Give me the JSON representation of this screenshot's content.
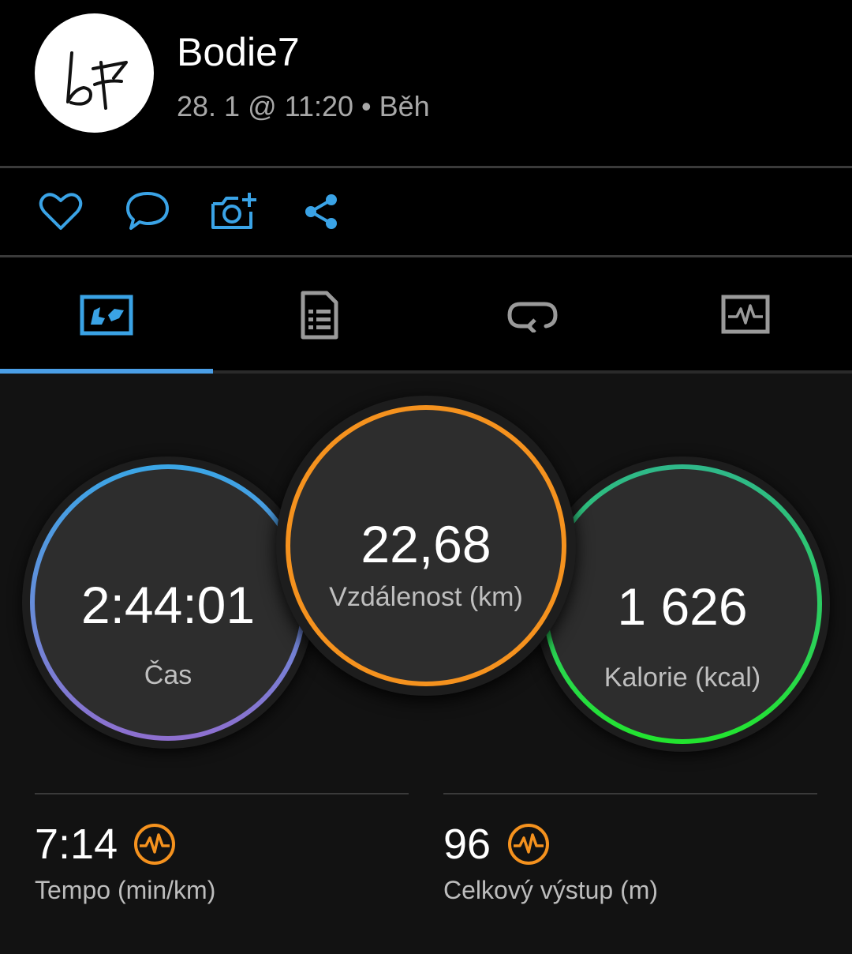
{
  "header": {
    "username": "Bodie7",
    "subtitle": "28. 1 @ 11:20 • Běh",
    "avatar_initials": "b7"
  },
  "actions": {
    "icons": [
      "heart-icon",
      "comment-icon",
      "add-photo-icon",
      "share-icon"
    ],
    "accent_color": "#3aa3e6"
  },
  "tabs": {
    "icons": [
      "map-overview-icon",
      "details-list-icon",
      "laps-icon",
      "charts-icon"
    ],
    "selected": 0,
    "indicator_color": "#4a9ee6"
  },
  "stats": {
    "time": {
      "value": "2:44:01",
      "label": "Čas"
    },
    "distance": {
      "value": "22,68",
      "label": "Vzdálenost (km)"
    },
    "calories": {
      "value": "1 626",
      "label": "Kalorie (kcal)"
    },
    "pace": {
      "value": "7:14",
      "label": "Tempo (min/km)",
      "icon": "activity-pulse-icon"
    },
    "ascent": {
      "value": "96",
      "label": "Celkový výstup (m)",
      "icon": "activity-pulse-icon"
    }
  },
  "colors": {
    "time_ring": [
      "#3aa6e6",
      "#8a6fd0"
    ],
    "distance_ring": "#f5921e",
    "calories_ring": [
      "#2fc27a",
      "#26e03a"
    ],
    "metric_icon": "#f5921e"
  }
}
